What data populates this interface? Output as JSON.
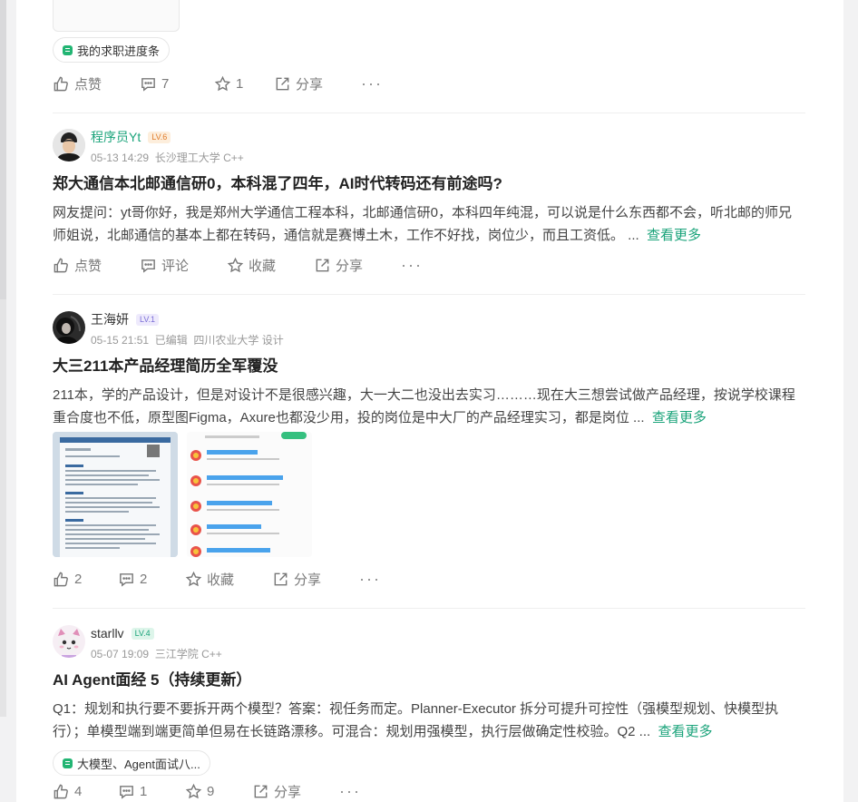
{
  "colors": {
    "accent_green": "#1aa37a",
    "page_bg": "#f2f2f3",
    "card_bg": "#ffffff"
  },
  "post0": {
    "tag": "我的求职进度条",
    "actions": {
      "like": "点赞",
      "comment": "7",
      "collect": "1",
      "share": "分享",
      "more": "···"
    }
  },
  "post1": {
    "author": "程序员Yt",
    "level": "LV.6",
    "date": "05-13 14:29",
    "school": "长沙理工大学 C++",
    "title": "郑大通信本北邮通信研0，本科混了四年，AI时代转码还有前途吗?",
    "body": "网友提问：yt哥你好，我是郑州大学通信工程本科，北邮通信研0，本科四年纯混，可以说是什么东西都不会，听北邮的师兄师姐说，北邮通信的基本上都在转码，通信就是赛博土木，工作不好找，岗位少，而且工资低。 ...",
    "see_more": "查看更多",
    "actions": {
      "like": "点赞",
      "comment": "评论",
      "collect": "收藏",
      "share": "分享",
      "more": "···"
    }
  },
  "post2": {
    "author": "王海妍",
    "level": "LV.1",
    "date": "05-15 21:51",
    "edited": "已编辑",
    "school": "四川农业大学 设计",
    "title": "大三211本产品经理简历全军覆没",
    "body": "211本，学的产品设计，但是对设计不是很感兴趣，大一大二也没出去实习………现在大三想尝试做产品经理，按说学校课程重合度也不低，原型图Figma，Axure也都没少用，投的岗位是中大厂的产品经理实习，都是岗位 ...",
    "see_more": "查看更多",
    "actions": {
      "like": "2",
      "comment": "2",
      "collect": "收藏",
      "share": "分享",
      "more": "···"
    }
  },
  "post3": {
    "author": "starllv",
    "level": "LV.4",
    "date": "05-07 19:09",
    "school": "三江学院 C++",
    "title": "AI Agent面经 5（持续更新）",
    "body": "Q1：规划和执行要不要拆开两个模型？答案：视任务而定。Planner-Executor 拆分可提升可控性（强模型规划、快模型执行）；单模型端到端更简单但易在长链路漂移。可混合：规划用强模型，执行层做确定性校验。Q2 ...",
    "see_more": "查看更多",
    "tag": "大模型、Agent面试八...",
    "actions": {
      "like": "4",
      "comment": "1",
      "collect": "9",
      "share": "分享",
      "more": "···"
    }
  }
}
